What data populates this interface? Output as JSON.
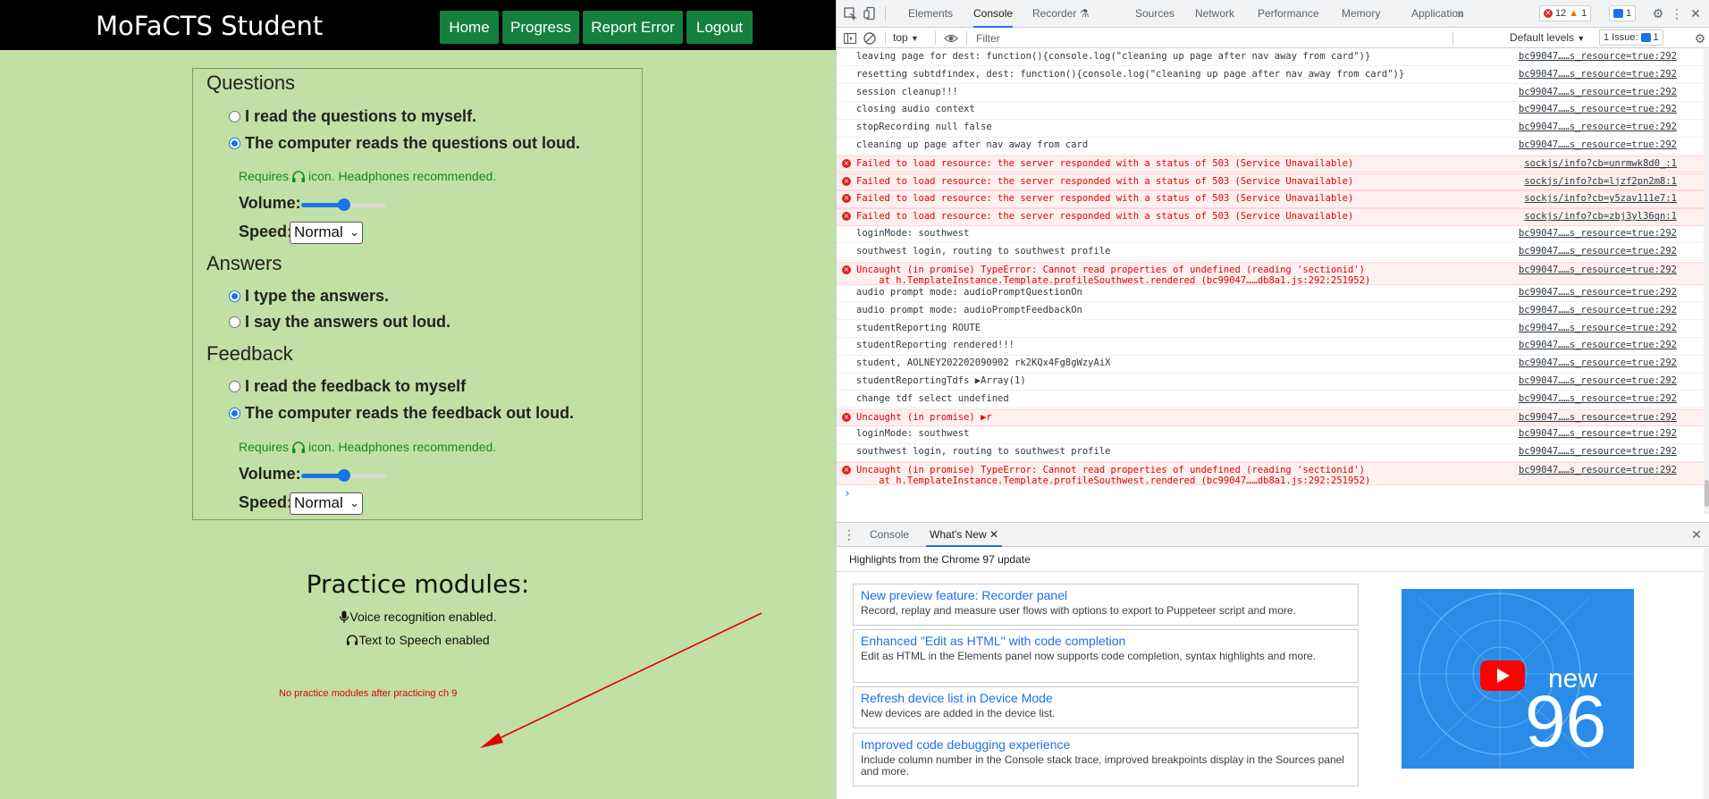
{
  "app": {
    "brand": "MoFaCTS Student",
    "nav": [
      "Home",
      "Progress",
      "Report Error",
      "Logout"
    ],
    "questions": {
      "heading": "Questions",
      "opt1": "I read the questions to myself.",
      "opt2": "The computer reads the questions out loud.",
      "selected": 2,
      "requires_pre": "Requires",
      "requires_post": "icon. Headphones recommended.",
      "volume_label": "Volume:",
      "volume_level": 0.5,
      "speed_label": "Speed:",
      "speed_value": "Normal"
    },
    "answers": {
      "heading": "Answers",
      "opt1": "I type the answers.",
      "opt2": "I say the answers out loud.",
      "selected": 1
    },
    "feedback": {
      "heading": "Feedback",
      "opt1": "I read the feedback to myself",
      "opt2": "The computer reads the feedback out loud.",
      "selected": 2,
      "requires_pre": "Requires",
      "requires_post": "icon. Headphones recommended.",
      "volume_label": "Volume:",
      "volume_level": 0.5,
      "speed_label": "Speed:",
      "speed_value": "Normal"
    },
    "practice_title": "Practice modules:",
    "voice_feature": "Voice recognition enabled.",
    "tts_feature": "Text to Speech enabled",
    "annotation": "No practice modules after practicing ch 9",
    "annotation_color": "#e00000",
    "background_color": "#c1e0a5",
    "button_color": "#15803d"
  },
  "devtools": {
    "tabs": [
      "Elements",
      "Console",
      "Recorder",
      "Sources",
      "Network",
      "Performance",
      "Memory",
      "Application"
    ],
    "active_tab": "Console",
    "error_count": "12",
    "warning_count": "1",
    "info_count": "1",
    "context": "top",
    "filter_placeholder": "Filter",
    "levels": "Default levels",
    "issues": "1 Issue:",
    "issues_count": "1",
    "log": [
      {
        "type": "log",
        "msg": "leaving page for dest: function(){console.log(\"cleaning up page after nav away from card\")}",
        "src": "bc99047……s_resource=true:292"
      },
      {
        "type": "log",
        "msg": "resetting subtdfindex, dest: function(){console.log(\"cleaning up page after nav away from card\")}",
        "src": "bc99047……s_resource=true:292"
      },
      {
        "type": "log",
        "msg": "session cleanup!!!",
        "src": "bc99047……s_resource=true:292"
      },
      {
        "type": "log",
        "msg": "closing audio context",
        "src": "bc99047……s_resource=true:292"
      },
      {
        "type": "log",
        "msg": "stopRecording null false",
        "src": "bc99047……s_resource=true:292"
      },
      {
        "type": "log",
        "msg": "cleaning up page after nav away from card",
        "src": "bc99047……s_resource=true:292"
      },
      {
        "type": "error",
        "msg": "Failed to load resource: the server responded with a status of 503 (Service Unavailable)",
        "src": "sockjs/info?cb=unrmwk8d0_:1"
      },
      {
        "type": "error",
        "msg": "Failed to load resource: the server responded with a status of 503 (Service Unavailable)",
        "src": "sockjs/info?cb=ljzf2pn2m8:1"
      },
      {
        "type": "error",
        "msg": "Failed to load resource: the server responded with a status of 503 (Service Unavailable)",
        "src": "sockjs/info?cb=y5zav111e7:1"
      },
      {
        "type": "error",
        "msg": "Failed to load resource: the server responded with a status of 503 (Service Unavailable)",
        "src": "sockjs/info?cb=zbj3yl36qn:1"
      },
      {
        "type": "log",
        "msg": "loginMode: southwest",
        "src": "bc99047……s_resource=true:292"
      },
      {
        "type": "log",
        "msg": "southwest login, routing to southwest profile",
        "src": "bc99047……s_resource=true:292"
      },
      {
        "type": "error2",
        "msg": "Uncaught (in promise) TypeError: Cannot read properties of undefined (reading 'sectionid')",
        "sub": "    at h.TemplateInstance.Template.profileSouthwest.rendered (bc99047……db8a1.js:292:251952)",
        "src": "bc99047……s_resource=true:292"
      },
      {
        "type": "log",
        "msg": "audio prompt mode: audioPromptQuestionOn",
        "src": "bc99047……s_resource=true:292"
      },
      {
        "type": "log",
        "msg": "audio prompt mode: audioPromptFeedbackOn",
        "src": "bc99047……s_resource=true:292"
      },
      {
        "type": "log",
        "msg": "studentReporting ROUTE",
        "src": "bc99047……s_resource=true:292"
      },
      {
        "type": "log",
        "msg": "studentReporting rendered!!!",
        "src": "bc99047……s_resource=true:292"
      },
      {
        "type": "log",
        "msg": "student, AOLNEY202202090902 rk2KQx4Fg8gWzyAiX",
        "src": "bc99047……s_resource=true:292"
      },
      {
        "type": "log",
        "msg": "studentReportingTdfs ▶Array(1)",
        "src": "bc99047……s_resource=true:292"
      },
      {
        "type": "log",
        "msg": "change tdf select undefined",
        "src": "bc99047……s_resource=true:292"
      },
      {
        "type": "error",
        "msg": "Uncaught (in promise) ▶r",
        "src": "bc99047……s_resource=true:292"
      },
      {
        "type": "log",
        "msg": "loginMode: southwest",
        "src": "bc99047……s_resource=true:292"
      },
      {
        "type": "log",
        "msg": "southwest login, routing to southwest profile",
        "src": "bc99047……s_resource=true:292"
      },
      {
        "type": "error2",
        "msg": "Uncaught (in promise) TypeError: Cannot read properties of undefined (reading 'sectionid')",
        "sub": "    at h.TemplateInstance.Template.profileSouthwest.rendered (bc99047……db8a1.js:292:251952)",
        "src": "bc99047……s_resource=true:292"
      }
    ],
    "drawer": {
      "tabs": [
        "Console",
        "What's New"
      ],
      "active_tab": "What's New",
      "heading": "Highlights from the Chrome 97 update",
      "cards": [
        {
          "title": "New preview feature: Recorder panel",
          "desc": "Record, replay and measure user flows with options to export to Puppeteer script and more."
        },
        {
          "title": "Enhanced \"Edit as HTML\" with code completion",
          "desc": "Edit as HTML in the Elements panel now supports code completion, syntax highlights and more."
        },
        {
          "title": "Refresh device list in Device Mode",
          "desc": "New devices are added in the device list."
        },
        {
          "title": "Improved code debugging experience",
          "desc": "Include column number in the Console stack trace, improved breakpoints display in the Sources panel and more."
        }
      ],
      "promo_new": "new",
      "promo_number": "96"
    }
  }
}
